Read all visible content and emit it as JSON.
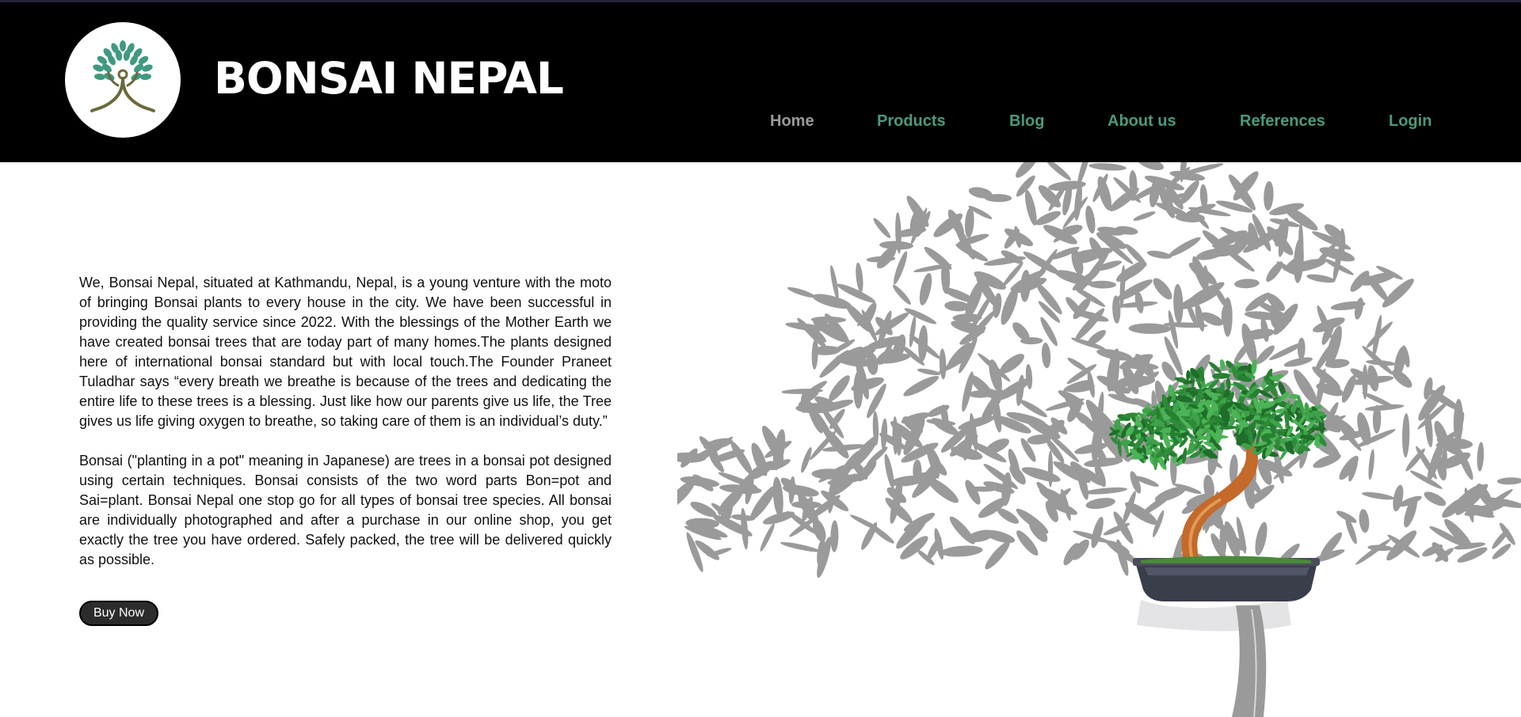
{
  "header": {
    "brand": "BONSAI NEPAL",
    "logo_icon": "tree-icon"
  },
  "nav": {
    "items": [
      {
        "label": "Home",
        "active": true
      },
      {
        "label": "Products",
        "active": false
      },
      {
        "label": "Blog",
        "active": false
      },
      {
        "label": "About us",
        "active": false
      },
      {
        "label": "References",
        "active": false
      },
      {
        "label": "Login",
        "active": false
      }
    ]
  },
  "main": {
    "paragraph1": "We, Bonsai Nepal, situated at Kathmandu, Nepal, is a young venture with the moto of bringing Bonsai plants to every house in the city. We have been successful in providing the quality service since 2022. With the blessings of the Mother Earth we have created bonsai trees that are today part of many homes.The plants designed here of international bonsai standard but with local touch.The Founder Praneet Tuladhar says “every breath we breathe is because of the trees and dedicating the entire life to these trees is a blessing. Just like how our parents give us life, the Tree gives us life giving oxygen to breathe, so taking care of them is an individual’s duty.”",
    "paragraph2": "Bonsai (\"planting in a pot\" meaning in Japanese) are trees in a bonsai pot designed using certain techniques. Bonsai consists of the two word parts Bon=pot and Sai=plant. Bonsai Nepal one stop go for all types of bonsai tree species. All bonsai are individually photographed and after a purchase in our online shop, you get exactly the tree you have ordered. Safely packed, the tree will be delivered quickly as possible.",
    "buy_label": "Buy Now"
  },
  "colors": {
    "header_bg": "#000000",
    "nav_link": "#4a9a7d",
    "nav_active": "#9a9a9a",
    "leaf_gray": "#9a9a9a",
    "foliage_green": "#2e8b3a",
    "trunk": "#c46a2a",
    "pot": "#3a3d4a"
  },
  "hero": {
    "image_icon": "bonsai-illustration"
  }
}
